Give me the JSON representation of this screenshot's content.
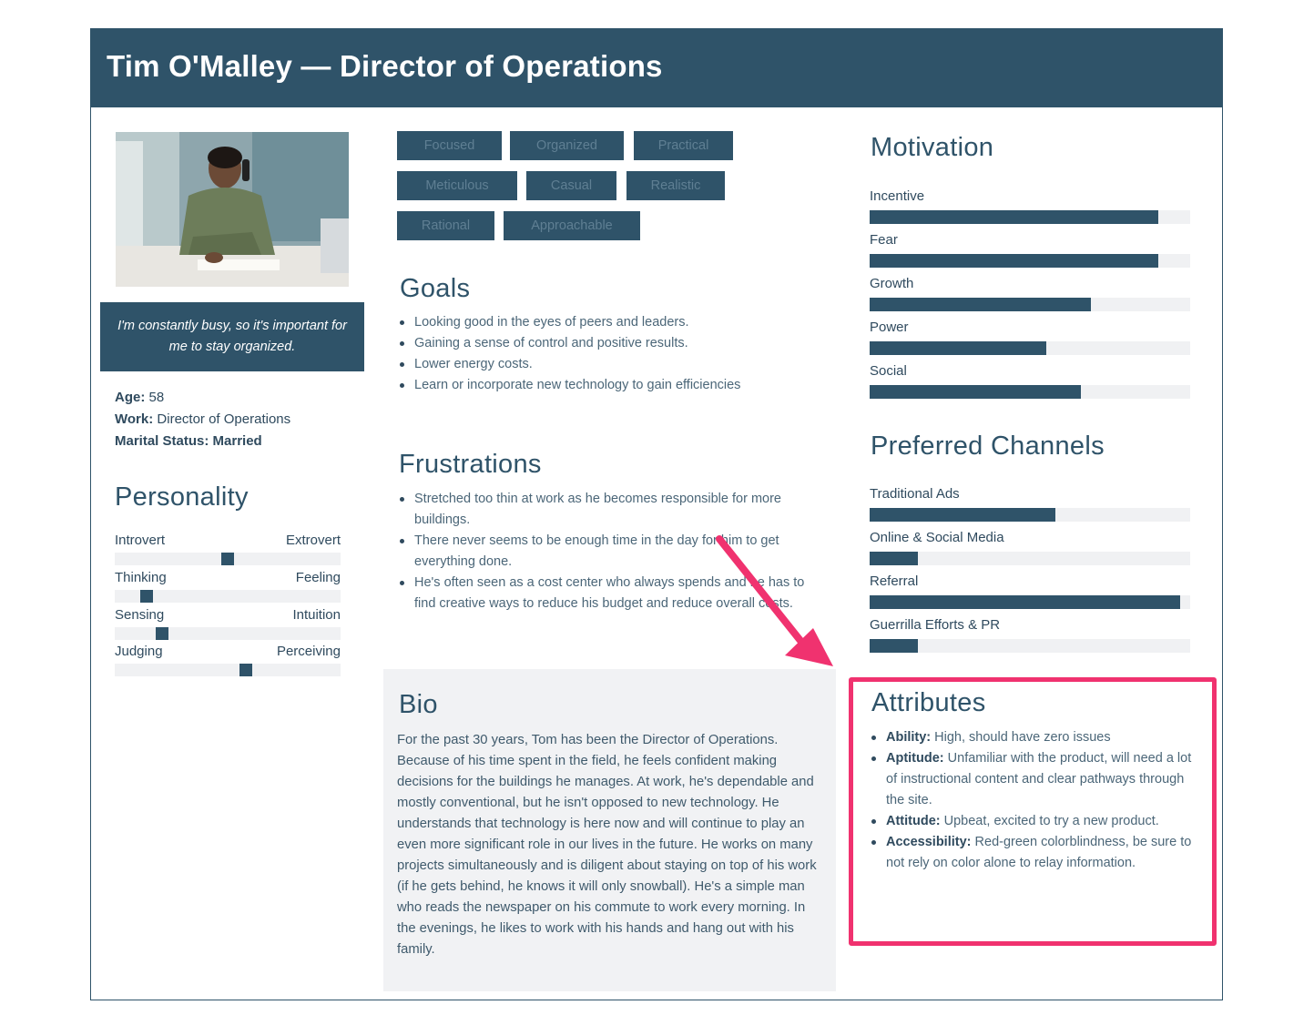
{
  "title": "Tim O'Malley — Director of Operations",
  "quote": "I'm constantly busy, so it's important for me to stay organized.",
  "facts": [
    {
      "label": "Age:",
      "value": "58"
    },
    {
      "label": "Work:",
      "value": "Director of Operations"
    },
    {
      "label": "Marital Status:",
      "value": "Married"
    }
  ],
  "personality": {
    "title": "Personality",
    "traits": [
      {
        "left": "Introvert",
        "right": "Extrovert",
        "level": 0.5
      },
      {
        "left": "Thinking",
        "right": "Feeling",
        "level": 0.14
      },
      {
        "left": "Sensing",
        "right": "Intuition",
        "level": 0.21
      },
      {
        "left": "Judging",
        "right": "Perceiving",
        "level": 0.58
      }
    ]
  },
  "tags": [
    "Focused",
    "Organized",
    "Practical",
    "Meticulous",
    "Casual",
    "Realistic",
    "Rational",
    "Approachable"
  ],
  "goals": {
    "title": "Goals",
    "items": [
      "Looking good in the eyes of peers and leaders.",
      "Gaining a sense of control and positive results.",
      "Lower energy costs.",
      "Learn or incorporate new technology to gain efficiencies"
    ]
  },
  "frustrations": {
    "title": "Frustrations",
    "items": [
      "Stretched too thin at work as he becomes responsible for more buildings.",
      "There never seems to be enough time in the day for him to get everything done.",
      "He's often seen as a cost center who always spends and he has to find creative ways to reduce his budget and reduce overall costs."
    ]
  },
  "bio": {
    "title": "Bio",
    "text": "For the past 30 years, Tom has been the Director of Operations. Because of his time spent in the field, he feels confident making decisions for the buildings he manages. At work, he's dependable and mostly conventional, but he isn't opposed to new technology. He understands that technology is here now and will continue to play an even more significant role in our lives in the future. He works on many projects simultaneously and is diligent about staying on top of his work (if he gets behind, he knows it will only snowball). He's a simple man who reads the newspaper on his commute to work every morning. In the evenings, he likes to work with his hands and hang out with his family."
  },
  "motivation": {
    "title": "Motivation",
    "items": [
      {
        "label": "Incentive",
        "value": 0.9
      },
      {
        "label": "Fear",
        "value": 0.9
      },
      {
        "label": "Growth",
        "value": 0.69
      },
      {
        "label": "Power",
        "value": 0.55
      },
      {
        "label": "Social",
        "value": 0.66
      }
    ]
  },
  "channels": {
    "title": "Preferred Channels",
    "items": [
      {
        "label": "Traditional Ads",
        "value": 0.58
      },
      {
        "label": "Online & Social Media",
        "value": 0.15
      },
      {
        "label": "Referral",
        "value": 0.97
      },
      {
        "label": "Guerrilla Efforts & PR",
        "value": 0.15
      }
    ]
  },
  "attributes": {
    "title": "Attributes",
    "items": [
      {
        "label": "Ability:",
        "text": "High, should have zero issues"
      },
      {
        "label": "Aptitude:",
        "text": "Unfamiliar with the product, will need a lot of instructional content and clear pathways through the site."
      },
      {
        "label": "Attitude:",
        "text": "Upbeat, excited to try a new product."
      },
      {
        "label": "Accessibility:",
        "text": "Red-green colorblindness, be sure to not rely on color alone to relay information."
      }
    ]
  },
  "colors": {
    "primary": "#2f5369",
    "highlight": "#f0326f",
    "track": "#f0f1f3"
  }
}
